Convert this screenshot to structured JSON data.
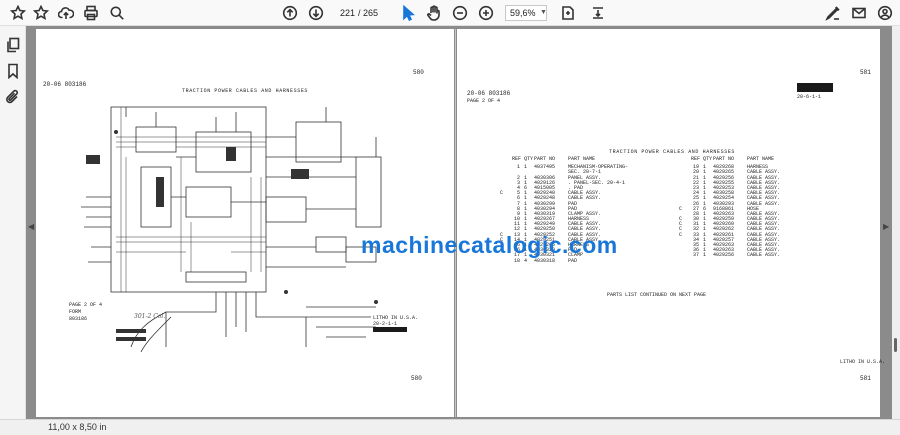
{
  "toolbar": {
    "page_current": "221",
    "page_total": "/ 265",
    "zoom": "59,6%"
  },
  "status": {
    "page_size": "11,00 x 8,50 in"
  },
  "left_page": {
    "page_no_top": "580",
    "page_no_bottom": "580",
    "doc_ref": "20-06   803186",
    "title": "TRACTION POWER CABLES AND HARNESSES",
    "footer_page": "PAGE 2 OF 4",
    "footer_form": "FORM",
    "footer_code": "803186",
    "handwriting": "301-2 Col.",
    "litho": "LITHO IN U.S.A.",
    "litho_code": "20-2-1-1"
  },
  "right_page": {
    "page_no_top": "581",
    "page_no_bottom": "581",
    "doc_ref": "20-06   803186",
    "sub_ref": "20-6-1-1",
    "page_of": "PAGE 2 OF 4",
    "title": "TRACTION POWER CABLES AND HARNESSES",
    "headers": {
      "ref": "REF",
      "qty": "QTY",
      "part_no": "PART NO",
      "part_name": "PART NAME"
    },
    "parts_left": [
      {
        "k": "",
        "ref": "1",
        "qty": "1",
        "pn": "4037495",
        "name": "MECHANISM-OPERATING-"
      },
      {
        "k": "",
        "ref": "",
        "qty": "",
        "pn": "",
        "name": "  SEC. 20-7-1"
      },
      {
        "k": "",
        "ref": "2",
        "qty": "1",
        "pn": "4030306",
        "name": "PANEL ASSY."
      },
      {
        "k": "",
        "ref": "3",
        "qty": "1",
        "pn": "4029126",
        "name": ". PANEL-SEC. 20-4-1"
      },
      {
        "k": "",
        "ref": "4",
        "qty": "6",
        "pn": "4015005",
        "name": ". PAD"
      },
      {
        "k": "C",
        "ref": "5",
        "qty": "1",
        "pn": "4029240",
        "name": "CABLE ASSY."
      },
      {
        "k": "",
        "ref": "6",
        "qty": "1",
        "pn": "4029248",
        "name": "CABLE ASSY."
      },
      {
        "k": "",
        "ref": "7",
        "qty": "1",
        "pn": "4030299",
        "name": "PAD"
      },
      {
        "k": "",
        "ref": "8",
        "qty": "1",
        "pn": "4030294",
        "name": "PAD"
      },
      {
        "k": "",
        "ref": "9",
        "qty": "1",
        "pn": "4030319",
        "name": "CLAMP ASSY."
      },
      {
        "k": "",
        "ref": "10",
        "qty": "1",
        "pn": "4029267",
        "name": "HARNESS"
      },
      {
        "k": "",
        "ref": "11",
        "qty": "1",
        "pn": "4029249",
        "name": "CABLE ASSY."
      },
      {
        "k": "",
        "ref": "12",
        "qty": "1",
        "pn": "4029250",
        "name": "CABLE ASSY."
      },
      {
        "k": "C",
        "ref": "13",
        "qty": "1",
        "pn": "4029252",
        "name": "CABLE ASSY."
      },
      {
        "k": "C",
        "ref": "14",
        "qty": "1",
        "pn": "4029251",
        "name": "CABLE ASSY."
      },
      {
        "k": "",
        "ref": "16",
        "qty": "1",
        "pn": "4029266",
        "name": "HARNESS"
      },
      {
        "k": "",
        "ref": "16",
        "qty": "1",
        "pn": "4030320",
        "name": "PAD"
      },
      {
        "k": "",
        "ref": "17",
        "qty": "1",
        "pn": "4030321",
        "name": "CLAMP"
      },
      {
        "k": "",
        "ref": "18",
        "qty": "4",
        "pn": "4030318",
        "name": "PAD"
      }
    ],
    "parts_right": [
      {
        "k": "",
        "ref": "19",
        "qty": "1",
        "pn": "4029268",
        "name": "HARNESS"
      },
      {
        "k": "",
        "ref": "20",
        "qty": "1",
        "pn": "4029265",
        "name": "CABLE ASSY."
      },
      {
        "k": "",
        "ref": "21",
        "qty": "1",
        "pn": "4029256",
        "name": "CABLE ASSY."
      },
      {
        "k": "",
        "ref": "22",
        "qty": "1",
        "pn": "4029255",
        "name": "CABLE ASSY."
      },
      {
        "k": "",
        "ref": "23",
        "qty": "1",
        "pn": "4029253",
        "name": "CABLE ASSY."
      },
      {
        "k": "",
        "ref": "24",
        "qty": "1",
        "pn": "4030258",
        "name": "CABLE ASSY."
      },
      {
        "k": "",
        "ref": "25",
        "qty": "1",
        "pn": "4029254",
        "name": "CABLE ASSY."
      },
      {
        "k": "",
        "ref": "26",
        "qty": "1",
        "pn": "4030293",
        "name": "CABLE ASSY."
      },
      {
        "k": "C",
        "ref": "27",
        "qty": "6",
        "pn": "9168861",
        "name": "HOSE"
      },
      {
        "k": "",
        "ref": "28",
        "qty": "1",
        "pn": "4029263",
        "name": "CABLE ASSY."
      },
      {
        "k": "C",
        "ref": "30",
        "qty": "1",
        "pn": "4029259",
        "name": "CABLE ASSY."
      },
      {
        "k": "C",
        "ref": "31",
        "qty": "1",
        "pn": "4029260",
        "name": "CABLE ASSY."
      },
      {
        "k": "C",
        "ref": "32",
        "qty": "1",
        "pn": "4029262",
        "name": "CABLE ASSY."
      },
      {
        "k": "C",
        "ref": "33",
        "qty": "1",
        "pn": "4029261",
        "name": "CABLE ASSY."
      },
      {
        "k": "",
        "ref": "34",
        "qty": "1",
        "pn": "4029257",
        "name": "CABLE ASSY."
      },
      {
        "k": "",
        "ref": "35",
        "qty": "1",
        "pn": "4029263",
        "name": "CABLE ASSY."
      },
      {
        "k": "",
        "ref": "36",
        "qty": "1",
        "pn": "4029263",
        "name": "CABLE ASSY."
      },
      {
        "k": "",
        "ref": "37",
        "qty": "1",
        "pn": "4029256",
        "name": "CABLE ASSY."
      }
    ],
    "continued": "PARTS LIST CONTINUED ON NEXT PAGE",
    "litho": "LITHO IN U.S.A."
  },
  "watermark": "machinecatalogic.com",
  "icons": {
    "star": "star-icon",
    "upload": "upload-icon",
    "print": "print-icon",
    "search": "search-icon",
    "prev": "page-up-icon",
    "next": "page-down-icon",
    "cursor": "select-cursor-icon",
    "hand": "hand-tool-icon",
    "zoom_out": "zoom-out-icon",
    "zoom_in": "zoom-in-icon",
    "fit": "fit-page-icon",
    "scroll_mode": "scroll-mode-icon",
    "sign": "sign-icon",
    "mail": "mail-icon",
    "account": "account-icon",
    "pages": "pages-panel-icon",
    "bookmarks": "bookmarks-icon",
    "attachments": "attachments-icon"
  },
  "accent_color": "#1877d8"
}
